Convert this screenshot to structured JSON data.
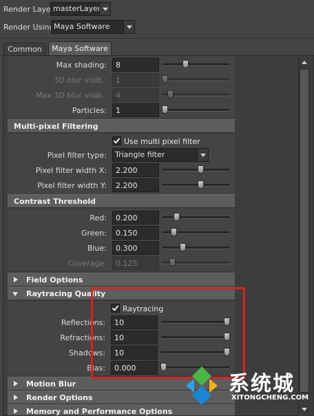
{
  "top": {
    "render_layer_label": "Render Layer",
    "render_layer_value": "masterLayer",
    "render_using_label": "Render Using",
    "render_using_value": "Maya Software"
  },
  "tabs": [
    {
      "label": "Common",
      "active": false
    },
    {
      "label": "Maya Software",
      "active": true
    }
  ],
  "blur_rows": [
    {
      "label": "Max shading:",
      "value": "8",
      "disabled": false
    },
    {
      "label": "3D blur visib.:",
      "value": "1",
      "disabled": true
    },
    {
      "label": "Max 3D blur visib.:",
      "value": "4",
      "disabled": true
    },
    {
      "label": "Particles:",
      "value": "1",
      "disabled": false
    }
  ],
  "multipixel": {
    "title": "Multi-pixel Filtering",
    "checkbox_label": "Use multi pixel filter",
    "checked": true,
    "filter_type_label": "Pixel filter type:",
    "filter_type_value": "Triangle filter",
    "width_x_label": "Pixel filter width X:",
    "width_x_value": "2.200",
    "width_y_label": "Pixel filter width Y:",
    "width_y_value": "2.200"
  },
  "contrast": {
    "title": "Contrast Threshold",
    "rows": [
      {
        "label": "Red:",
        "value": "0.200",
        "disabled": false
      },
      {
        "label": "Green:",
        "value": "0.150",
        "disabled": false
      },
      {
        "label": "Blue:",
        "value": "0.300",
        "disabled": false
      },
      {
        "label": "Coverage:",
        "value": "0.125",
        "disabled": true
      }
    ]
  },
  "field_options": {
    "title": "Field Options"
  },
  "raytracing": {
    "title": "Raytracing Quality",
    "checkbox_label": "Raytracing",
    "checked": true,
    "rows": [
      {
        "label": "Reflections:",
        "value": "10"
      },
      {
        "label": "Refractions:",
        "value": "10"
      },
      {
        "label": "Shadows:",
        "value": "10"
      },
      {
        "label": "Bias:",
        "value": "0.000"
      }
    ]
  },
  "collapsed_sections": [
    {
      "title": "Motion Blur"
    },
    {
      "title": "Render Options"
    },
    {
      "title": "Memory and Performance Options"
    }
  ],
  "watermark": {
    "brand": "系统城",
    "url": "XITONGCHENG.COM"
  },
  "colors": {
    "highlight_box": "#d42424",
    "background": "#444444",
    "header": "#5d5d5d"
  }
}
